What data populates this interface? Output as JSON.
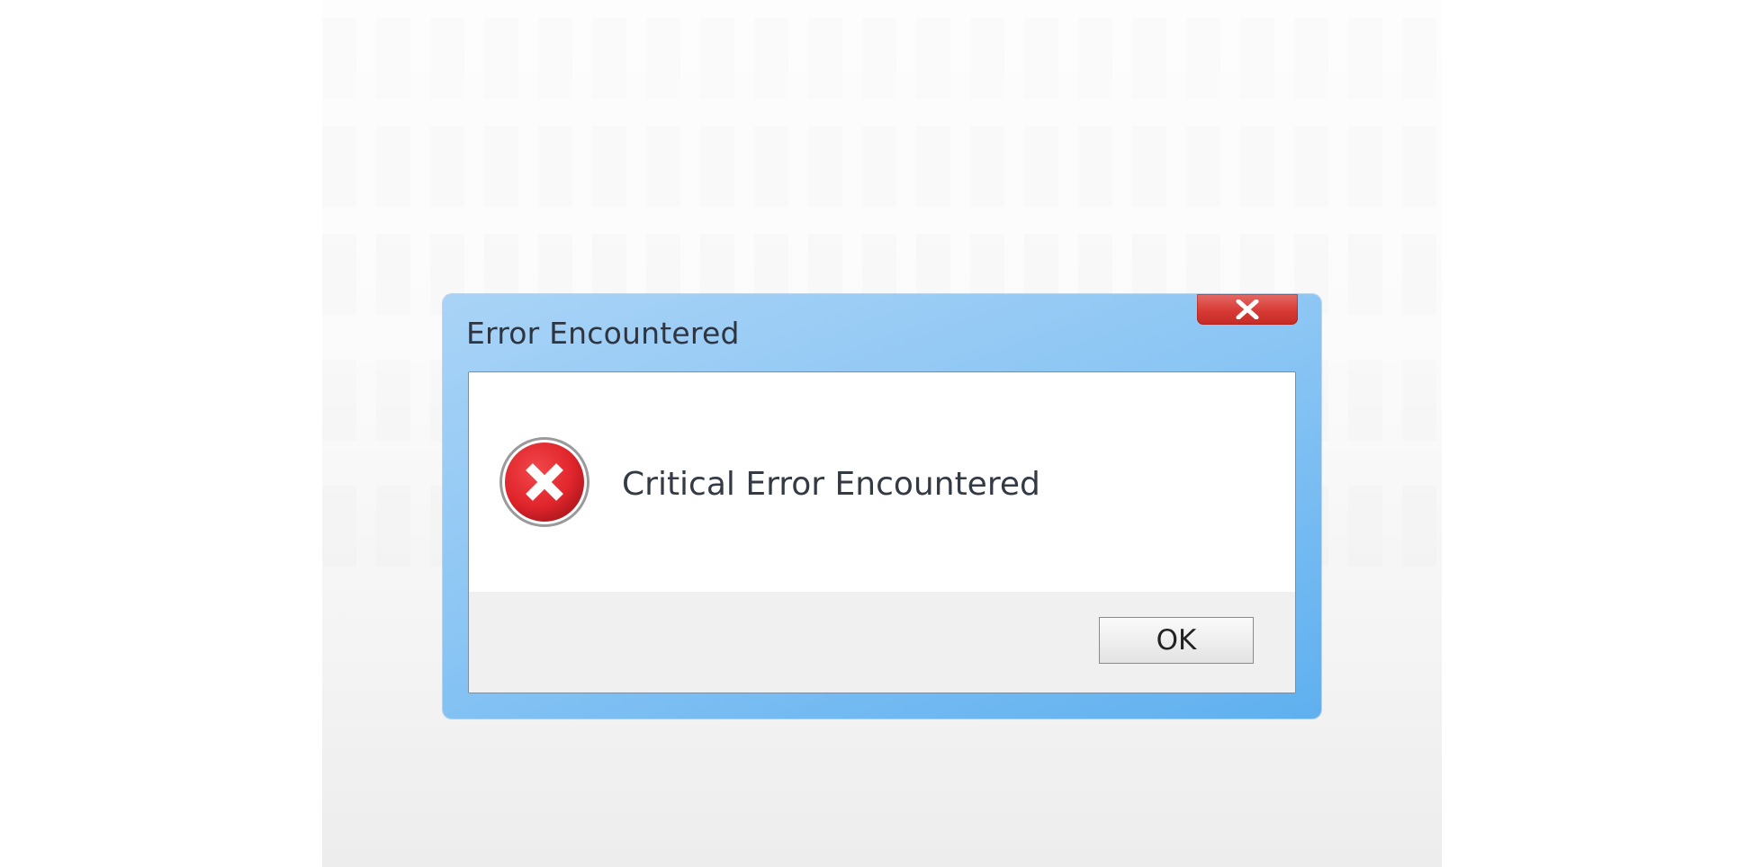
{
  "dialog": {
    "title": "Error Encountered",
    "close_icon": "close-x-icon",
    "message": "Critical Error Encountered",
    "status_icon": "error-x-circle-icon",
    "ok_label": "OK"
  },
  "colors": {
    "titlebar": "#8cc6f4",
    "close_button": "#d73a34",
    "error_icon": "#e0262c",
    "button_bar": "#f0f0f0"
  }
}
